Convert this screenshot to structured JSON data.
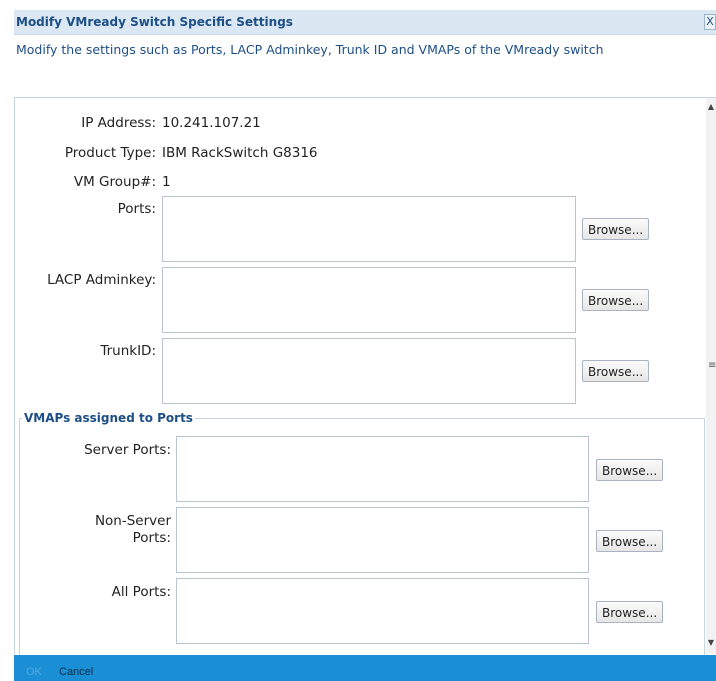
{
  "dialog": {
    "title": "Modify VMready Switch Specific Settings",
    "close_glyph": "X",
    "description": "Modify the settings such as Ports, LACP Adminkey, Trunk ID and VMAPs of the VMready switch"
  },
  "info": {
    "ip_label": "IP Address:",
    "ip_value": "10.241.107.21",
    "product_label": "Product Type:",
    "product_value": "IBM RackSwitch G8316",
    "vmgroup_label": "VM Group#:",
    "vmgroup_value": "1"
  },
  "fields": {
    "ports_label": "Ports:",
    "ports_value": "",
    "lacp_label": "LACP Adminkey:",
    "lacp_value": "",
    "trunk_label": "TrunkID:",
    "trunk_value": "",
    "browse_label": "Browse..."
  },
  "vmaps": {
    "legend": "VMAPs assigned to Ports",
    "server_ports_label": "Server Ports:",
    "server_ports_value": "",
    "non_server_ports_label_line1": "Non-Server",
    "non_server_ports_label_line2": "Ports:",
    "non_server_ports_value": "",
    "all_ports_label": "All Ports:",
    "all_ports_value": ""
  },
  "footer": {
    "ok_label": "OK",
    "cancel_label": "Cancel"
  },
  "scrollbar": {
    "up_icon": "▲",
    "grip_icon": "≡",
    "down_icon": "▼"
  },
  "colors": {
    "title_blue": "#1d4f86",
    "titlebar_bg": "#dbe7f3",
    "footer_bg": "#1a8fd6"
  }
}
